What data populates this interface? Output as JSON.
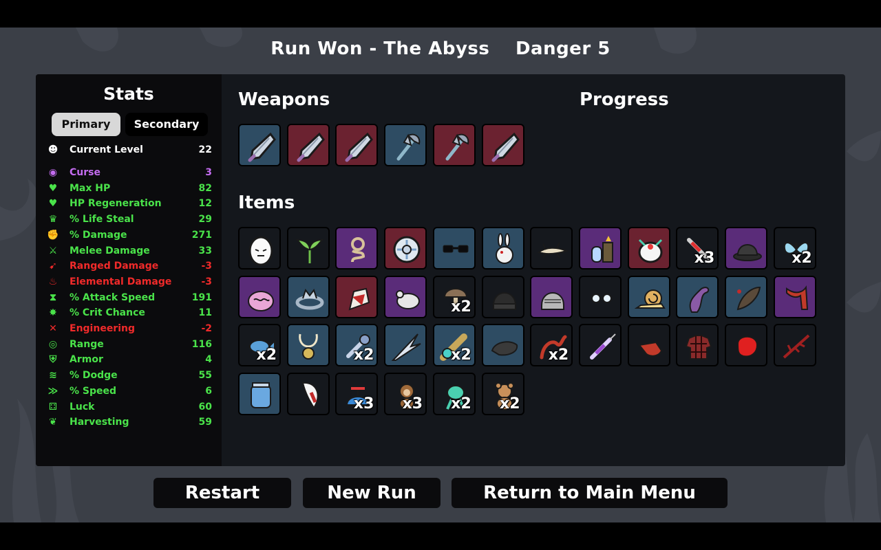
{
  "header": {
    "run_result": "Run Won - The Abyss",
    "danger": "Danger 5"
  },
  "stats": {
    "title": "Stats",
    "tabs": {
      "primary": "Primary",
      "secondary": "Secondary"
    },
    "rows": [
      {
        "label": "Current Level",
        "value": "22",
        "icon": "level-icon",
        "color": "#ffffff",
        "glyph": "☻"
      },
      {
        "label": "Curse",
        "value": "3",
        "icon": "curse-icon",
        "color": "#c46cf0",
        "glyph": "◉"
      },
      {
        "label": "Max HP",
        "value": "82",
        "icon": "heart-icon",
        "color": "#4ae34a",
        "glyph": "♥"
      },
      {
        "label": "HP Regeneration",
        "value": "12",
        "icon": "regen-heart-icon",
        "color": "#4ae34a",
        "glyph": "♥"
      },
      {
        "label": "% Life Steal",
        "value": "29",
        "icon": "life-steal-icon",
        "color": "#4ae34a",
        "glyph": "♛"
      },
      {
        "label": "% Damage",
        "value": "271",
        "icon": "damage-fist-icon",
        "color": "#4ae34a",
        "glyph": "✊"
      },
      {
        "label": "Melee Damage",
        "value": "33",
        "icon": "sword-icon",
        "color": "#4ae34a",
        "glyph": "⚔"
      },
      {
        "label": "Ranged Damage",
        "value": "-3",
        "icon": "ranged-icon",
        "color": "#f02a2a",
        "glyph": "➹"
      },
      {
        "label": "Elemental Damage",
        "value": "-3",
        "icon": "flame-icon",
        "color": "#f02a2a",
        "glyph": "♨"
      },
      {
        "label": "% Attack Speed",
        "value": "191",
        "icon": "hourglass-icon",
        "color": "#4ae34a",
        "glyph": "⧗"
      },
      {
        "label": "% Crit Chance",
        "value": "11",
        "icon": "crit-icon",
        "color": "#4ae34a",
        "glyph": "✸"
      },
      {
        "label": "Engineering",
        "value": "-2",
        "icon": "wrench-icon",
        "color": "#f02a2a",
        "glyph": "✕"
      },
      {
        "label": "Range",
        "value": "116",
        "icon": "range-icon",
        "color": "#4ae34a",
        "glyph": "◎"
      },
      {
        "label": "Armor",
        "value": "4",
        "icon": "shield-icon",
        "color": "#4ae34a",
        "glyph": "⛨"
      },
      {
        "label": "% Dodge",
        "value": "55",
        "icon": "dodge-icon",
        "color": "#4ae34a",
        "glyph": "≋"
      },
      {
        "label": "% Speed",
        "value": "6",
        "icon": "speed-boot-icon",
        "color": "#4ae34a",
        "glyph": "≫"
      },
      {
        "label": "Luck",
        "value": "60",
        "icon": "dice-icon",
        "color": "#4ae34a",
        "glyph": "⚃"
      },
      {
        "label": "Harvesting",
        "value": "59",
        "icon": "wheat-icon",
        "color": "#4ae34a",
        "glyph": "❦"
      }
    ]
  },
  "weapons": {
    "title": "Weapons",
    "slots": [
      {
        "icon": "spear-tip-icon",
        "tier_color": "#2e4c63"
      },
      {
        "icon": "spear-tip-icon",
        "tier_color": "#6b2230"
      },
      {
        "icon": "spear-tip-icon",
        "tier_color": "#6b2230"
      },
      {
        "icon": "axe-icon",
        "tier_color": "#2e4c63"
      },
      {
        "icon": "axe-icon",
        "tier_color": "#6b2230"
      },
      {
        "icon": "spear-tip-icon",
        "tier_color": "#6b2230"
      }
    ]
  },
  "progress": {
    "title": "Progress"
  },
  "items": {
    "title": "Items",
    "slots": [
      {
        "icon": "egg-icon",
        "tier_color": "#15181d",
        "count": ""
      },
      {
        "icon": "sprout-icon",
        "tier_color": "#15181d",
        "count": ""
      },
      {
        "icon": "rope-icon",
        "tier_color": "#5a2c79",
        "count": ""
      },
      {
        "icon": "shield-orb-icon",
        "tier_color": "#6b2230",
        "count": ""
      },
      {
        "icon": "glasses-icon",
        "tier_color": "#2e4c63",
        "count": ""
      },
      {
        "icon": "bunny-icon",
        "tier_color": "#2e4c63",
        "count": ""
      },
      {
        "icon": "lizard-icon",
        "tier_color": "#15181d",
        "count": ""
      },
      {
        "icon": "potion-fire-icon",
        "tier_color": "#5a2c79",
        "count": ""
      },
      {
        "icon": "eye-robot-icon",
        "tier_color": "#6b2230",
        "count": ""
      },
      {
        "icon": "syringe-icon",
        "tier_color": "#15181d",
        "count": "x3"
      },
      {
        "icon": "bowler-hat-icon",
        "tier_color": "#5a2c79",
        "count": ""
      },
      {
        "icon": "butterfly-icon",
        "tier_color": "#15181d",
        "count": "x2"
      },
      {
        "icon": "brain-icon",
        "tier_color": "#5a2c79",
        "count": ""
      },
      {
        "icon": "crown-ring-icon",
        "tier_color": "#2e4c63",
        "count": ""
      },
      {
        "icon": "bloody-hand-icon",
        "tier_color": "#6b2230",
        "count": ""
      },
      {
        "icon": "mouse-icon",
        "tier_color": "#5a2c79",
        "count": ""
      },
      {
        "icon": "mushroom-icon",
        "tier_color": "#15181d",
        "count": "x2"
      },
      {
        "icon": "beanie-icon",
        "tier_color": "#15181d",
        "count": ""
      },
      {
        "icon": "helmet-icon",
        "tier_color": "#5a2c79",
        "count": ""
      },
      {
        "icon": "eyes-icon",
        "tier_color": "#15181d",
        "count": ""
      },
      {
        "icon": "snail-icon",
        "tier_color": "#2e4c63",
        "count": ""
      },
      {
        "icon": "tentacle-icon",
        "tier_color": "#2e4c63",
        "count": ""
      },
      {
        "icon": "leech-icon",
        "tier_color": "#2e4c63",
        "count": ""
      },
      {
        "icon": "scarf-icon",
        "tier_color": "#5a2c79",
        "count": ""
      },
      {
        "icon": "fish-icon",
        "tier_color": "#15181d",
        "count": "x2"
      },
      {
        "icon": "amulet-icon",
        "tier_color": "#2e4c63",
        "count": ""
      },
      {
        "icon": "pipe-icon",
        "tier_color": "#2e4c63",
        "count": "x2"
      },
      {
        "icon": "shards-icon",
        "tier_color": "#2e4c63",
        "count": ""
      },
      {
        "icon": "spyglass-icon",
        "tier_color": "#2e4c63",
        "count": "x2"
      },
      {
        "icon": "rock-icon",
        "tier_color": "#2e4c63",
        "count": ""
      },
      {
        "icon": "worm-icon",
        "tier_color": "#15181d",
        "count": "x2"
      },
      {
        "icon": "injector-icon",
        "tier_color": "#15181d",
        "count": ""
      },
      {
        "icon": "whistle-icon",
        "tier_color": "#15181d",
        "count": ""
      },
      {
        "icon": "plaid-shirt-icon",
        "tier_color": "#15181d",
        "count": ""
      },
      {
        "icon": "boxing-glove-icon",
        "tier_color": "#15181d",
        "count": ""
      },
      {
        "icon": "thorn-branch-icon",
        "tier_color": "#15181d",
        "count": ""
      },
      {
        "icon": "jar-icon",
        "tier_color": "#2e4c63",
        "count": ""
      },
      {
        "icon": "fang-icon",
        "tier_color": "#15181d",
        "count": ""
      },
      {
        "icon": "propeller-hat-icon",
        "tier_color": "#15181d",
        "count": "x3"
      },
      {
        "icon": "monkey-icon",
        "tier_color": "#15181d",
        "count": "x3"
      },
      {
        "icon": "alien-icon",
        "tier_color": "#15181d",
        "count": "x2"
      },
      {
        "icon": "teddy-bear-icon",
        "tier_color": "#15181d",
        "count": "x2"
      }
    ]
  },
  "buttons": {
    "restart": "Restart",
    "new_run": "New Run",
    "main_menu": "Return to Main Menu"
  }
}
